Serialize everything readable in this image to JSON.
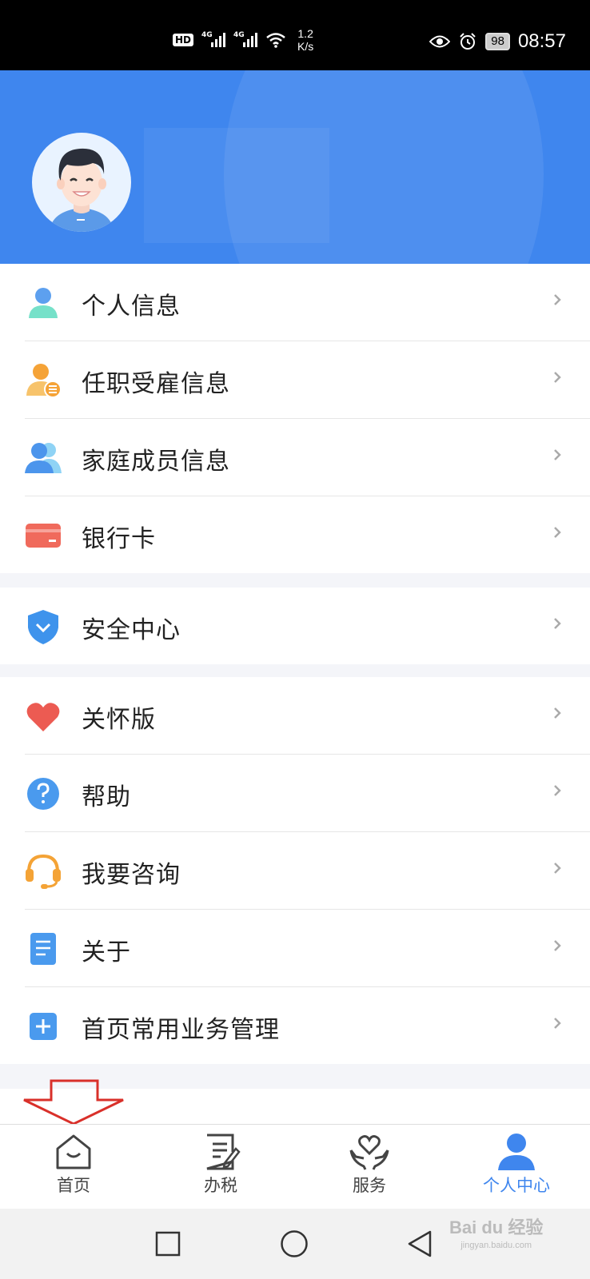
{
  "status_bar": {
    "hd_label": "HD",
    "network_1": "4G",
    "network_2": "4G",
    "speed_value": "1.2",
    "speed_unit": "K/s",
    "battery": "98",
    "time": "08:57"
  },
  "profile": {
    "avatar_icon": "user-avatar-illustration"
  },
  "menu_groups": [
    {
      "items": [
        {
          "label": "个人信息",
          "icon": "person-icon"
        },
        {
          "label": "任职受雇信息",
          "icon": "employment-icon"
        },
        {
          "label": "家庭成员信息",
          "icon": "family-icon"
        },
        {
          "label": "银行卡",
          "icon": "bank-card-icon"
        }
      ]
    },
    {
      "items": [
        {
          "label": "安全中心",
          "icon": "shield-icon"
        }
      ]
    },
    {
      "items": [
        {
          "label": "关怀版",
          "icon": "heart-icon"
        },
        {
          "label": "帮助",
          "icon": "help-icon"
        },
        {
          "label": "我要咨询",
          "icon": "headset-icon"
        },
        {
          "label": "关于",
          "icon": "document-icon"
        },
        {
          "label": "首页常用业务管理",
          "icon": "plus-icon"
        }
      ]
    }
  ],
  "bottom_nav": [
    {
      "label": "首页",
      "icon": "home-icon",
      "active": false
    },
    {
      "label": "办税",
      "icon": "tax-form-icon",
      "active": false
    },
    {
      "label": "服务",
      "icon": "service-heart-icon",
      "active": false
    },
    {
      "label": "个人中心",
      "icon": "person-center-icon",
      "active": true
    }
  ],
  "colors": {
    "accent": "#3f86ee",
    "header_bg": "#3f86ee",
    "annotation_arrow": "#d9302a"
  },
  "watermark": {
    "brand": "Bai du 经验",
    "url": "jingyan.baidu.com"
  }
}
